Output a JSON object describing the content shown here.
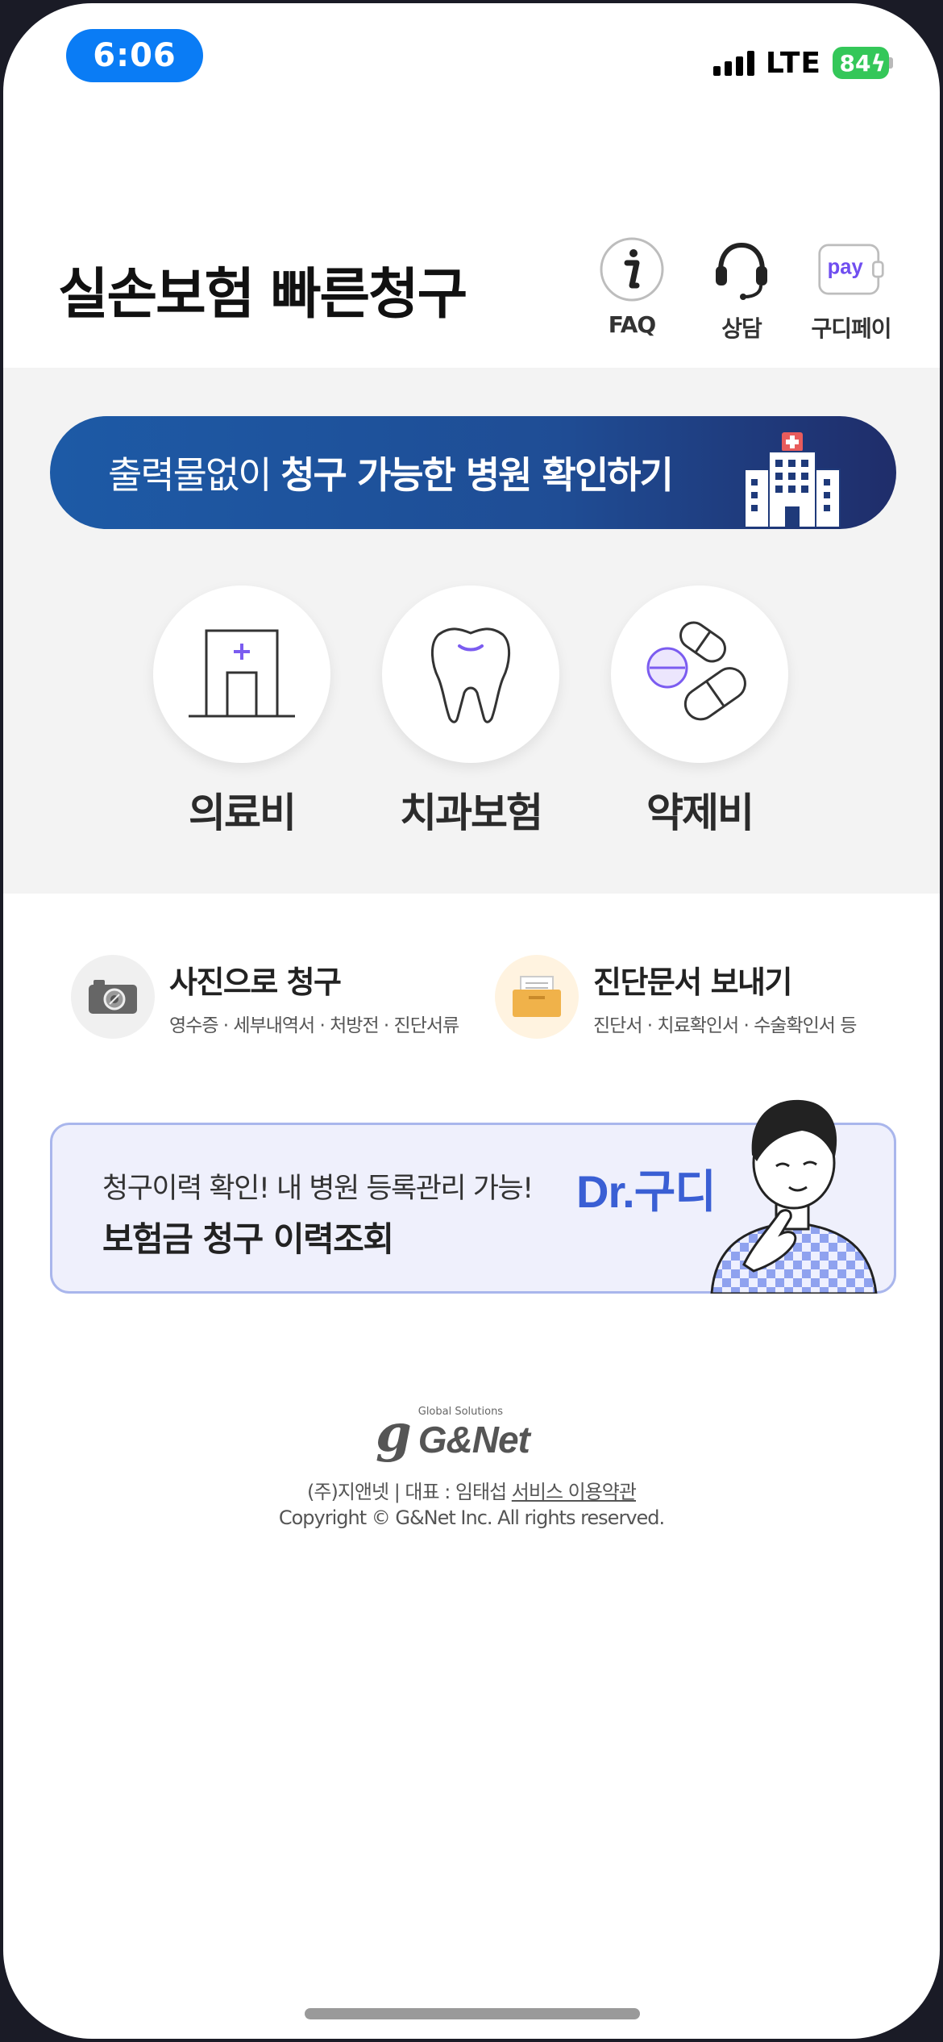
{
  "status_bar": {
    "time": "6:06",
    "network": "LTE",
    "battery": "84"
  },
  "header": {
    "title": "실손보험 빠른청구",
    "actions": [
      {
        "label": "FAQ",
        "icon": "info-icon"
      },
      {
        "label": "상담",
        "icon": "headset-icon"
      },
      {
        "label": "구디페이",
        "icon": "pay-icon",
        "icon_text": "pay"
      }
    ]
  },
  "hospital_banner": {
    "text_normal": "출력물없이 ",
    "text_bold": "청구 가능한 병원 확인하기",
    "icon": "hospital-building-icon"
  },
  "categories": [
    {
      "label": "의료비",
      "icon": "hospital-door-icon"
    },
    {
      "label": "치과보험",
      "icon": "tooth-icon"
    },
    {
      "label": "약제비",
      "icon": "pill-icon"
    }
  ],
  "quick_actions": [
    {
      "title": "사진으로 청구",
      "subtitle": "영수증 · 세부내역서 · 처방전 · 진단서류",
      "icon": "camera-icon"
    },
    {
      "title": "진단문서 보내기",
      "subtitle": "진단서 · 치료확인서 · 수술확인서 등",
      "icon": "document-folder-icon"
    }
  ],
  "history_banner": {
    "subtitle": "청구이력 확인! 내 병원 등록관리 가능!",
    "title": "보험금 청구 이력조회",
    "brand": "Dr.구디",
    "image": "doctor-character-illustration"
  },
  "footer": {
    "logo_mark": "g",
    "logo_tagline": "Global Solutions",
    "logo_name": "G&Net",
    "company": "(주)지앤넷 | 대표 : 임태섭 ",
    "terms_link": "서비스 이용약관",
    "copyright": "Copyright © G&Net Inc. All rights reserved."
  },
  "colors": {
    "primary_blue": "#1d5aa6",
    "accent_purple": "#7b5cf0",
    "brand_blue": "#3a5fd4",
    "time_pill": "#0a7cf5",
    "battery": "#34c759"
  }
}
